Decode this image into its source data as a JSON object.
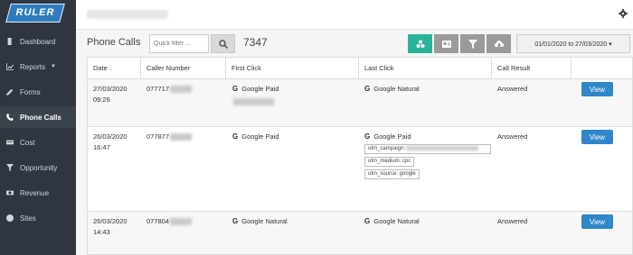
{
  "brand": {
    "name": "RULER"
  },
  "sidebar": {
    "items": [
      {
        "label": "Dashboard",
        "icon": "dashboard-icon"
      },
      {
        "label": "Reports",
        "icon": "chart-icon",
        "caret": "▼"
      },
      {
        "label": "Forms",
        "icon": "pencil-icon"
      },
      {
        "label": "Phone Calls",
        "icon": "phone-icon"
      },
      {
        "label": "Cost",
        "icon": "card-icon"
      },
      {
        "label": "Opportunity",
        "icon": "filter-icon"
      },
      {
        "label": "Revenue",
        "icon": "money-icon"
      },
      {
        "label": "Sites",
        "icon": "globe-icon"
      }
    ]
  },
  "header": {
    "title": "Phone Calls",
    "search_placeholder": "Quick filter ...",
    "count": "7347",
    "date_range": "01/01/2020 to 27/03/2020 ▾"
  },
  "table": {
    "columns": [
      "Date",
      "Caller Number",
      "First Click",
      "Last Click",
      "Call Result"
    ],
    "sort_indicator": "↓",
    "rows": [
      {
        "date": "27/03/2020",
        "time": "09:26",
        "caller": "077717",
        "first_click": "Google Paid",
        "last_click": "Google Natural",
        "result": "Answered",
        "action": "View"
      },
      {
        "date": "26/03/2020",
        "time": "16:47",
        "caller": "077877",
        "first_click": "Google Paid",
        "last_click": "Google Paid",
        "result": "Answered",
        "action": "View",
        "utm": [
          "utm_campaign:",
          "utm_medium: cpc",
          "utm_source: google"
        ]
      },
      {
        "date": "26/03/2020",
        "time": "14:43",
        "caller": "077804",
        "first_click": "Google Natural",
        "last_click": "Google Natural",
        "result": "Answered",
        "action": "View"
      }
    ]
  },
  "colors": {
    "sidebar": "#2f3640",
    "accent": "#2f86c8",
    "teal": "#2bb39a"
  }
}
